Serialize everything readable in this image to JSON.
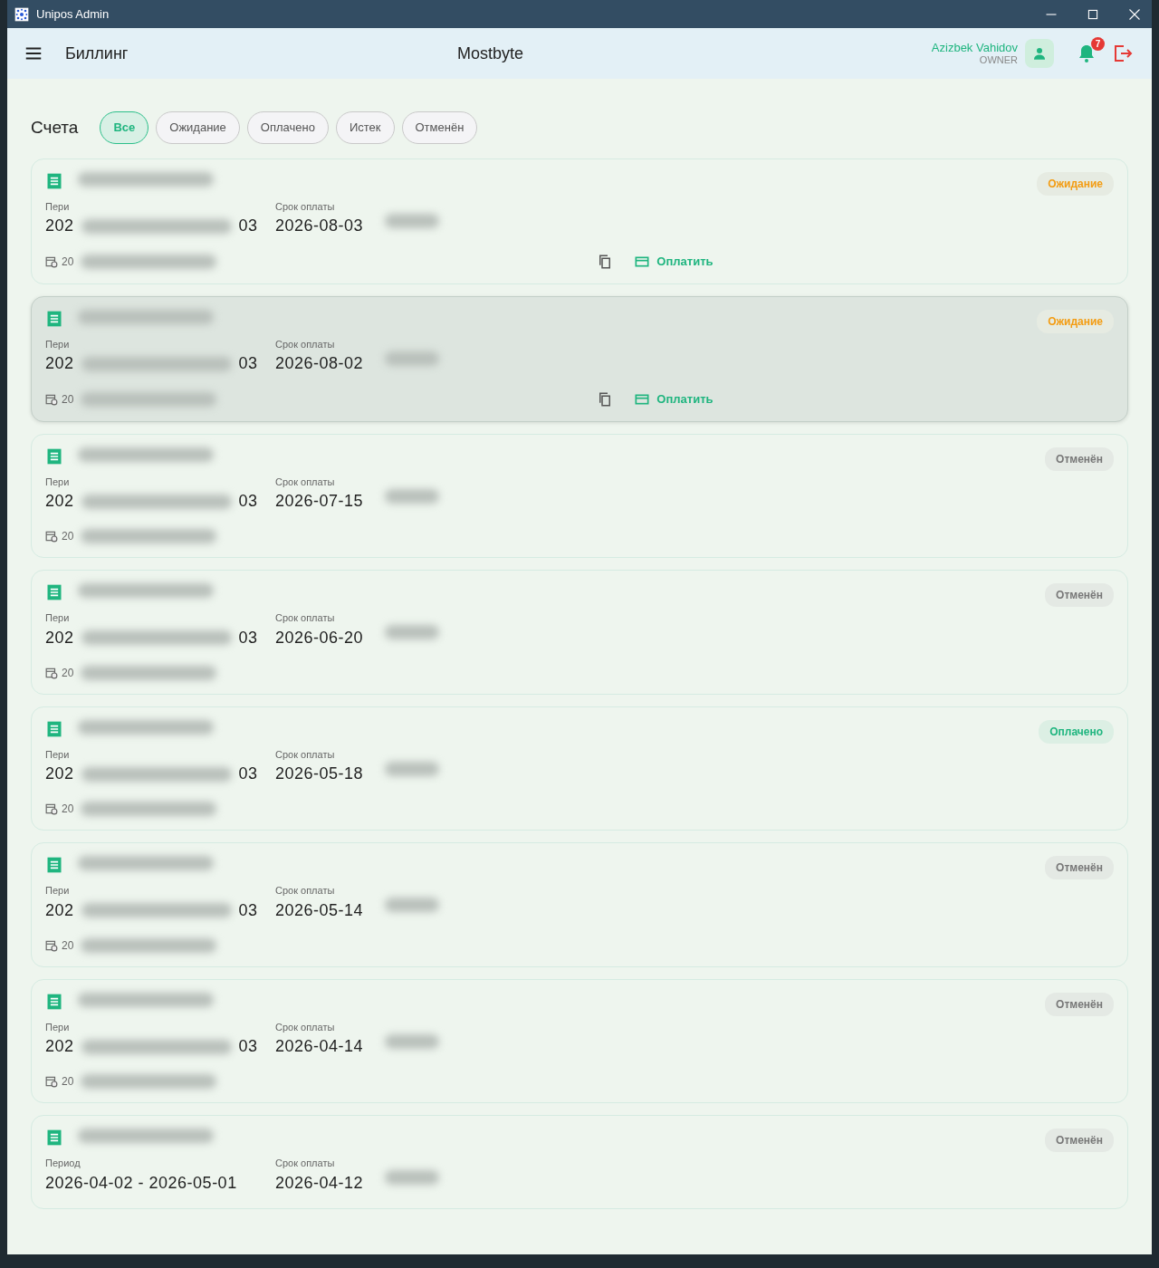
{
  "window": {
    "title": "Unipos Admin"
  },
  "header": {
    "page_title": "Биллинг",
    "company": "Mostbyte",
    "user_name": "Azizbek Vahidov",
    "user_role": "OWNER",
    "notifications": "7"
  },
  "section_title": "Счета",
  "filters": [
    {
      "label": "Все",
      "selected": true
    },
    {
      "label": "Ожидание",
      "selected": false
    },
    {
      "label": "Оплачено",
      "selected": false
    },
    {
      "label": "Истек",
      "selected": false
    },
    {
      "label": "Отменён",
      "selected": false
    }
  ],
  "invoices": [
    {
      "status": {
        "label": "Ожидание",
        "kind": "pending"
      },
      "highlighted": false,
      "period_label": "Пери",
      "period_start": "202",
      "period_end": "03",
      "due_label": "Срок оплаты",
      "due_date": "2026-08-03",
      "created": "20",
      "pay_label": "Оплатить"
    },
    {
      "status": {
        "label": "Ожидание",
        "kind": "pending"
      },
      "highlighted": true,
      "period_label": "Пери",
      "period_start": "202",
      "period_end": "03",
      "due_label": "Срок оплаты",
      "due_date": "2026-08-02",
      "created": "20",
      "pay_label": "Оплатить"
    },
    {
      "status": {
        "label": "Отменён",
        "kind": "cancelled"
      },
      "highlighted": false,
      "period_label": "Пери",
      "period_start": "202",
      "period_end": "03",
      "due_label": "Срок оплаты",
      "due_date": "2026-07-15",
      "created": "20"
    },
    {
      "status": {
        "label": "Отменён",
        "kind": "cancelled"
      },
      "highlighted": false,
      "period_label": "Пери",
      "period_start": "202",
      "period_end": "03",
      "due_label": "Срок оплаты",
      "due_date": "2026-06-20",
      "created": "20"
    },
    {
      "status": {
        "label": "Оплачено",
        "kind": "paid"
      },
      "highlighted": false,
      "period_label": "Пери",
      "period_start": "202",
      "period_end": "03",
      "due_label": "Срок оплаты",
      "due_date": "2026-05-18",
      "created": "20"
    },
    {
      "status": {
        "label": "Отменён",
        "kind": "cancelled"
      },
      "highlighted": false,
      "period_label": "Пери",
      "period_start": "202",
      "period_end": "03",
      "due_label": "Срок оплаты",
      "due_date": "2026-05-14",
      "created": "20"
    },
    {
      "status": {
        "label": "Отменён",
        "kind": "cancelled"
      },
      "highlighted": false,
      "period_label": "Пери",
      "period_start": "202",
      "period_end": "03",
      "due_label": "Срок оплаты",
      "due_date": "2026-04-14",
      "created": "20"
    },
    {
      "status": {
        "label": "Отменён",
        "kind": "cancelled"
      },
      "highlighted": false,
      "period_label": "Период",
      "period": "2026-04-02 - 2026-05-01",
      "due_label": "Срок оплаты",
      "due_date": "2026-04-12"
    }
  ]
}
